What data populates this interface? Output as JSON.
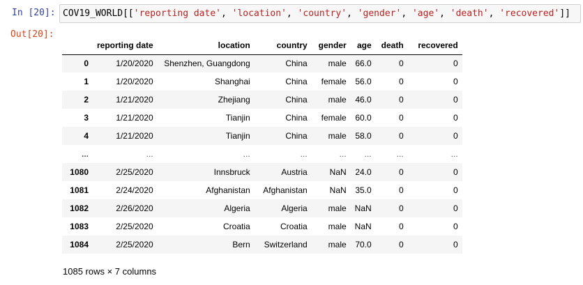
{
  "cell": {
    "in_prompt": "In [20]:",
    "out_prompt": "Out[20]:",
    "code": {
      "var": "COV19_WORLD",
      "open": "[[",
      "close": "]]",
      "strings": [
        "'reporting date'",
        "'location'",
        "'country'",
        "'gender'",
        "'age'",
        "'death'",
        "'recovered'"
      ],
      "sep": ", "
    }
  },
  "table": {
    "columns": [
      "",
      "reporting date",
      "location",
      "country",
      "gender",
      "age",
      "death",
      "recovered"
    ],
    "rows": [
      [
        "0",
        "1/20/2020",
        "Shenzhen, Guangdong",
        "China",
        "male",
        "66.0",
        "0",
        "0"
      ],
      [
        "1",
        "1/20/2020",
        "Shanghai",
        "China",
        "female",
        "56.0",
        "0",
        "0"
      ],
      [
        "2",
        "1/21/2020",
        "Zhejiang",
        "China",
        "male",
        "46.0",
        "0",
        "0"
      ],
      [
        "3",
        "1/21/2020",
        "Tianjin",
        "China",
        "female",
        "60.0",
        "0",
        "0"
      ],
      [
        "4",
        "1/21/2020",
        "Tianjin",
        "China",
        "male",
        "58.0",
        "0",
        "0"
      ],
      [
        "...",
        "...",
        "...",
        "...",
        "...",
        "...",
        "...",
        "..."
      ],
      [
        "1080",
        "2/25/2020",
        "Innsbruck",
        "Austria",
        "NaN",
        "24.0",
        "0",
        "0"
      ],
      [
        "1081",
        "2/24/2020",
        "Afghanistan",
        "Afghanistan",
        "NaN",
        "35.0",
        "0",
        "0"
      ],
      [
        "1082",
        "2/26/2020",
        "Algeria",
        "Algeria",
        "male",
        "NaN",
        "0",
        "0"
      ],
      [
        "1083",
        "2/25/2020",
        "Croatia",
        "Croatia",
        "male",
        "NaN",
        "0",
        "0"
      ],
      [
        "1084",
        "2/25/2020",
        "Bern",
        "Switzerland",
        "male",
        "70.0",
        "0",
        "0"
      ]
    ]
  },
  "footer": "1085 rows × 7 columns"
}
